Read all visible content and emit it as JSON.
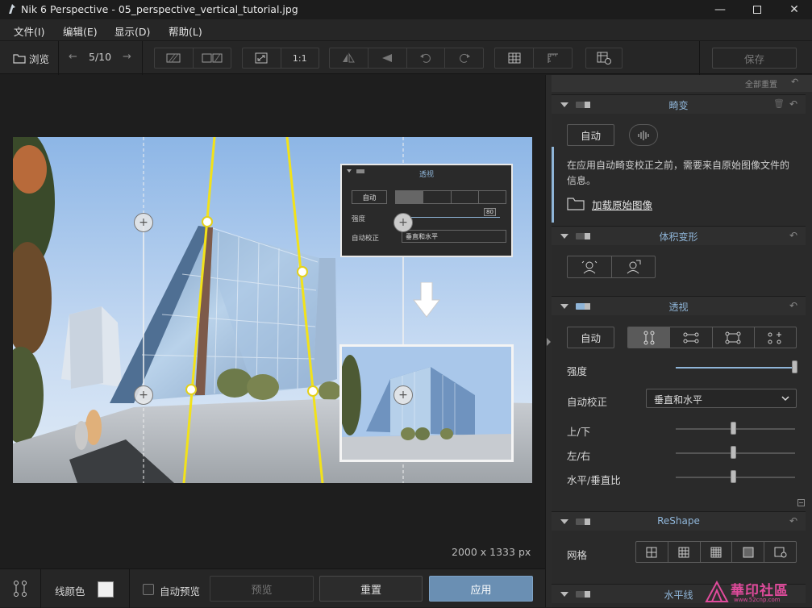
{
  "window": {
    "title": "Nik 6 Perspective - 05_perspective_vertical_tutorial.jpg"
  },
  "menu": {
    "items": [
      "文件(I)",
      "编辑(E)",
      "显示(D)",
      "帮助(L)"
    ]
  },
  "toolbar": {
    "browse_label": "浏览",
    "page_counter": "5/10",
    "one_to_one": "1:1",
    "save_label": "保存"
  },
  "canvas": {
    "image_size": "2000 x 1333 px"
  },
  "inset": {
    "title": "透视",
    "auto_label": "自动",
    "strength_label": "强度",
    "strength_value": "80",
    "auto_correct_label": "自动校正",
    "auto_correct_value": "垂直和水平"
  },
  "bottombar": {
    "line_color_label": "线颜色",
    "line_color": "#f0f0f0",
    "auto_preview_label": "自动预览",
    "preview_label": "预览",
    "reset_label": "重置",
    "apply_label": "应用"
  },
  "panel": {
    "reset_all": "全部重置",
    "distortion": {
      "title": "畸变",
      "auto_label": "自动",
      "info_text": "在应用自动畸变校正之前，需要来自原始图像文件的信息。",
      "load_original": "加载原始图像"
    },
    "volume": {
      "title": "体积变形"
    },
    "perspective": {
      "title": "透视",
      "auto_label": "自动",
      "strength_label": "强度",
      "strength": 1.0,
      "auto_correct_label": "自动校正",
      "auto_correct_value": "垂直和水平",
      "vertical_label": "上/下",
      "vertical": 0.5,
      "horizontal_label": "左/右",
      "horizontal": 0.5,
      "ratio_label": "水平/垂直比",
      "ratio": 0.5
    },
    "reshape": {
      "title": "ReShape",
      "grid_label": "网格"
    },
    "horizon": {
      "title": "水平线"
    }
  },
  "watermark": {
    "text": "華印社區",
    "sub": "www.52cnp.com"
  },
  "colors": {
    "accent": "#8fb5d8",
    "guide_yellow": "#f2e21a",
    "apply_bg": "#6a8fb3"
  }
}
